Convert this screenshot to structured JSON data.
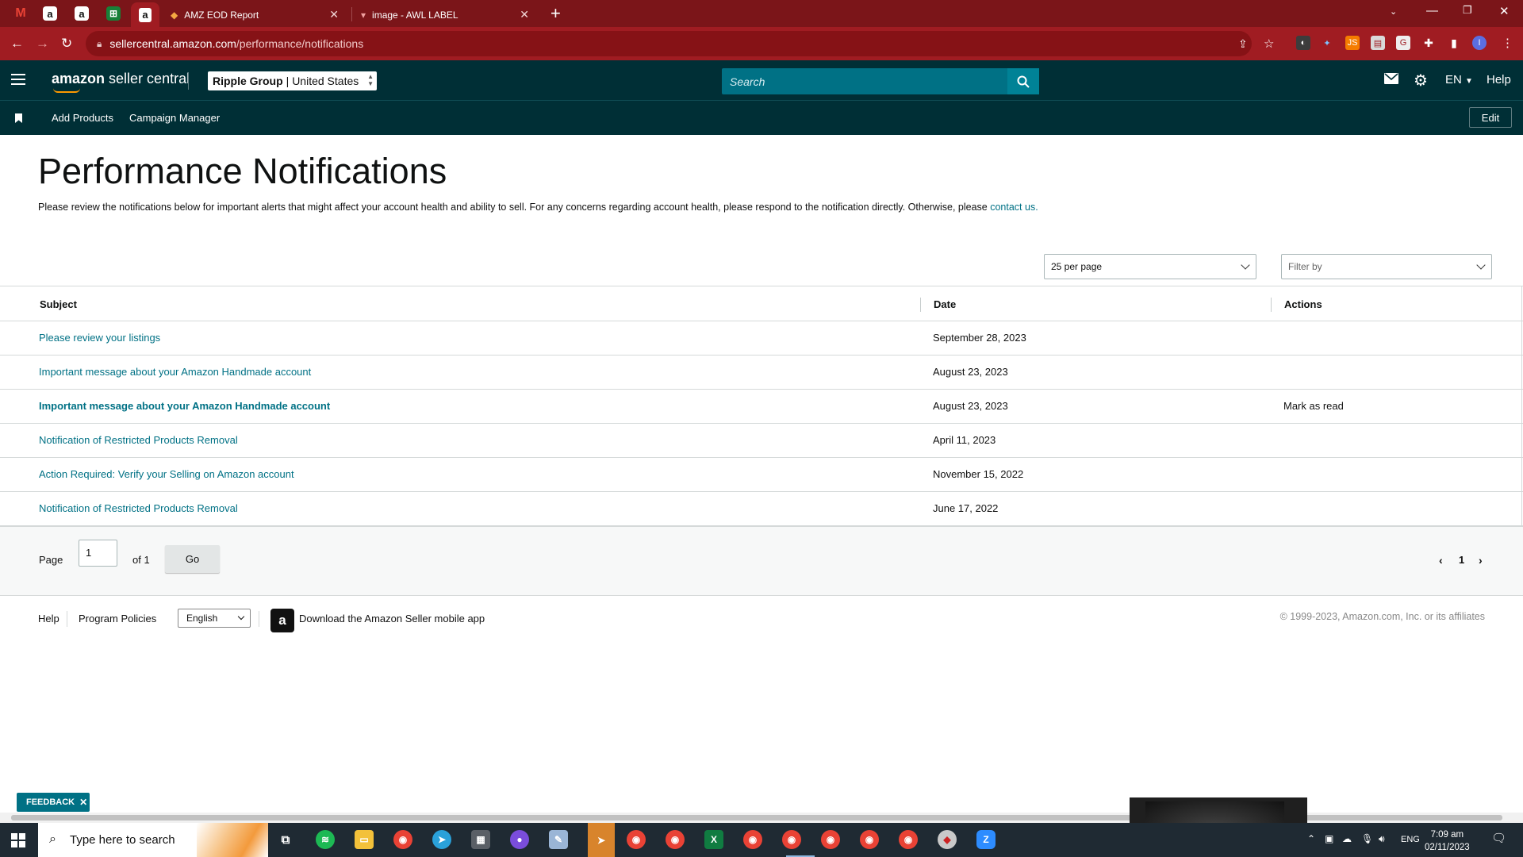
{
  "browser": {
    "tabs": [
      {
        "label": "AMZ EOD Report",
        "icon": "sheets-icon"
      },
      {
        "label": "image - AWL LABEL",
        "icon": "awl-icon"
      }
    ],
    "url_host": "sellercentral.amazon.com",
    "url_path": "/performance/notifications"
  },
  "header": {
    "logo_main": "amazon",
    "logo_sub": "seller central",
    "store_name": "Ripple Group",
    "store_region": "| United States",
    "search_placeholder": "Search",
    "language": "EN",
    "help": "Help"
  },
  "subnav": {
    "links": [
      "Add Products",
      "Campaign Manager"
    ],
    "edit": "Edit"
  },
  "page": {
    "title": "Performance Notifications",
    "intro": "Please review the notifications below for important alerts that might affect your account health and ability to sell. For any concerns regarding account health, please respond to the notification directly. Otherwise, please",
    "intro_link": "contact us.",
    "per_page": "25 per page",
    "filter_placeholder": "Filter by"
  },
  "table": {
    "columns": [
      "Subject",
      "Date",
      "Actions"
    ],
    "rows": [
      {
        "subject": "Please review your listings",
        "date": "September 28, 2023",
        "action": "",
        "unread": false
      },
      {
        "subject": "Important message about your Amazon Handmade account",
        "date": "August 23, 2023",
        "action": "",
        "unread": false
      },
      {
        "subject": "Important message about your Amazon Handmade account",
        "date": "August 23, 2023",
        "action": "Mark as read",
        "unread": true
      },
      {
        "subject": "Notification of Restricted Products Removal",
        "date": "April 11, 2023",
        "action": "",
        "unread": false
      },
      {
        "subject": "Action Required: Verify your Selling on Amazon account",
        "date": "November 15, 2022",
        "action": "",
        "unread": false
      },
      {
        "subject": "Notification of Restricted Products Removal",
        "date": "June 17, 2022",
        "action": "",
        "unread": false
      }
    ]
  },
  "pagination": {
    "page_label": "Page",
    "page_value": "1",
    "of_label": "of 1",
    "go": "Go",
    "current": "1"
  },
  "footer": {
    "help": "Help",
    "policies": "Program Policies",
    "language": "English",
    "app_text": "Download the Amazon Seller mobile app",
    "copyright": "© 1999-2023, Amazon.com, Inc. or its affiliates"
  },
  "feedback": "FEEDBACK",
  "taskbar": {
    "search_placeholder": "Type here to search",
    "lang": "ENG",
    "time": "7:09 am",
    "date": "02/11/2023"
  },
  "colors": {
    "chrome_tabbar": "#7b1519",
    "chrome_toolbar": "#a01c22",
    "seller_header": "#002f36",
    "link": "#007185"
  }
}
